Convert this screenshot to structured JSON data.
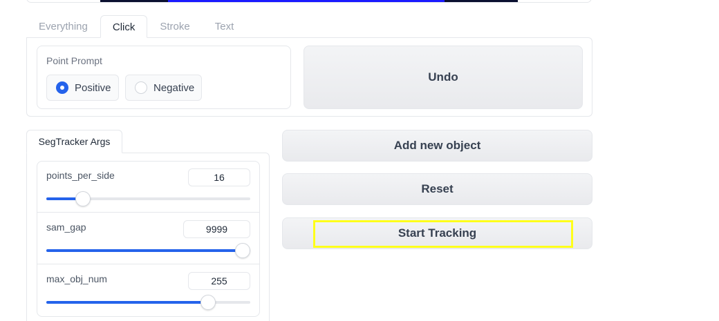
{
  "tabs": [
    {
      "label": "Everything",
      "active": false
    },
    {
      "label": "Click",
      "active": true
    },
    {
      "label": "Stroke",
      "active": false
    },
    {
      "label": "Text",
      "active": false
    }
  ],
  "point_prompt": {
    "label": "Point Prompt",
    "options": [
      {
        "label": "Positive",
        "checked": true
      },
      {
        "label": "Negative",
        "checked": false
      }
    ]
  },
  "buttons": {
    "undo": "Undo",
    "add_new_object": "Add new object",
    "reset": "Reset",
    "start_tracking": "Start Tracking"
  },
  "segtracker": {
    "tab_label": "SegTracker Args",
    "sliders": [
      {
        "label": "points_per_side",
        "value": "16",
        "fraction": 0.178
      },
      {
        "label": "sam_gap",
        "value": "9999",
        "fraction": 1.0
      },
      {
        "label": "max_obj_num",
        "value": "255",
        "fraction": 0.794
      }
    ]
  },
  "colors": {
    "accent": "#2563eb",
    "highlight": "#ffff1a",
    "border": "#e5e7eb"
  }
}
